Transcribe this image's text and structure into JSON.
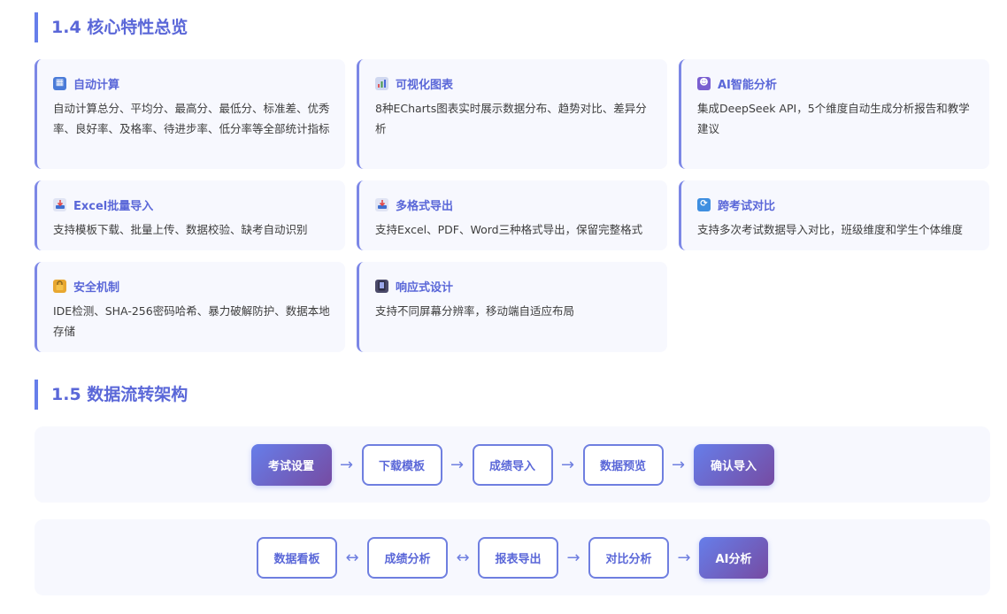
{
  "section1": {
    "title": "1.4 核心特性总览",
    "cards": [
      {
        "icon": "calculator-icon",
        "title": "自动计算",
        "desc": "自动计算总分、平均分、最高分、最低分、标准差、优秀率、良好率、及格率、待进步率、低分率等全部统计指标"
      },
      {
        "icon": "bar-chart-icon",
        "title": "可视化图表",
        "desc": "8种ECharts图表实时展示数据分布、趋势对比、差异分析"
      },
      {
        "icon": "robot-icon",
        "title": "AI智能分析",
        "desc": "集成DeepSeek API，5个维度自动生成分析报告和教学建议"
      },
      {
        "icon": "inbox-tray-icon",
        "title": "Excel批量导入",
        "desc": "支持模板下载、批量上传、数据校验、缺考自动识别"
      },
      {
        "icon": "inbox-tray-icon",
        "title": "多格式导出",
        "desc": "支持Excel、PDF、Word三种格式导出，保留完整格式"
      },
      {
        "icon": "refresh-icon",
        "title": "跨考试对比",
        "desc": "支持多次考试数据导入对比，班级维度和学生个体维度"
      },
      {
        "icon": "lock-icon",
        "title": "安全机制",
        "desc": "IDE检测、SHA-256密码哈希、暴力破解防护、数据本地存储"
      },
      {
        "icon": "mobile-phone-icon",
        "title": "响应式设计",
        "desc": "支持不同屏幕分辨率，移动端自适应布局"
      }
    ]
  },
  "section2": {
    "title": "1.5 数据流转架构",
    "flow1": {
      "steps": [
        "考试设置",
        "下载模板",
        "成绩导入",
        "数据预览",
        "确认导入"
      ],
      "arrows": [
        "→",
        "→",
        "→",
        "→"
      ]
    },
    "flow2": {
      "steps": [
        "数据看板",
        "成绩分析",
        "报表导出",
        "对比分析",
        "AI分析"
      ],
      "arrows": [
        "↔",
        "↔",
        "→",
        "→"
      ]
    }
  },
  "colors": {
    "accent": "#5a67d8",
    "gradient_start": "#667eea",
    "gradient_end": "#764ba2",
    "card_bg": "#f7f8fe"
  }
}
